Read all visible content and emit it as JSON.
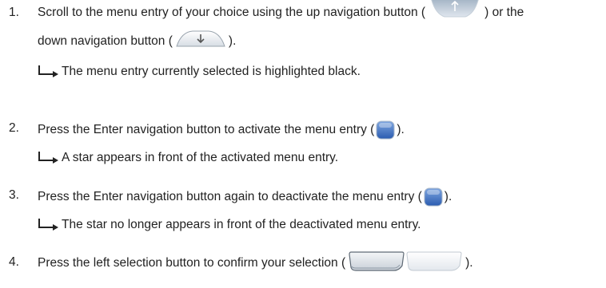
{
  "steps": [
    {
      "number": "1.",
      "line1_before": "Scroll to the menu entry of your choice using the up navigation button (",
      "line1_after": ") or the",
      "line2_before": "down navigation button (",
      "line2_after": ").",
      "result": "The menu entry currently selected is highlighted black."
    },
    {
      "number": "2.",
      "text_before": "Press the Enter navigation button to activate the menu entry (",
      "text_after": ").",
      "result": "A star appears in front of the activated menu entry."
    },
    {
      "number": "3.",
      "text_before": "Press the Enter navigation button again to deactivate the menu entry (",
      "text_after": ").",
      "result": "The star no longer appears in front of the deactivated menu entry."
    },
    {
      "number": "4.",
      "text_before": "Press the left selection button to confirm your selection (",
      "text_after": ")."
    }
  ],
  "icons": {
    "up_button": "up-navigation-button-icon",
    "down_button": "down-navigation-button-icon",
    "enter_button": "enter-navigation-button-icon",
    "left_selection_button": "left-selection-button-icon",
    "right_selection_button": "right-selection-button-icon",
    "result_arrow": "result-arrow-icon"
  },
  "colors": {
    "text": "#222222",
    "enter_button_blue": "#3a6fc4",
    "nav_button_gray": "#b9c7d6"
  }
}
